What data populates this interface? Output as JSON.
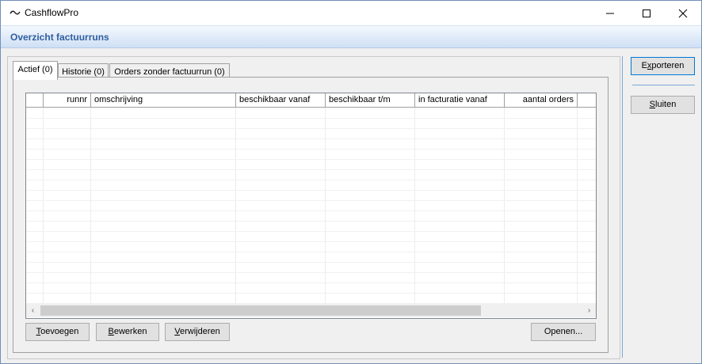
{
  "window": {
    "title": "CashflowPro",
    "minimize_icon": "minimize-icon",
    "maximize_icon": "maximize-icon",
    "close_icon": "close-icon"
  },
  "banner": {
    "title": "Overzicht factuurruns"
  },
  "tabs": [
    {
      "label": "Actief (0)",
      "active": true
    },
    {
      "label": "Historie (0)",
      "active": false
    },
    {
      "label": "Orders zonder factuurrun (0)",
      "active": false
    }
  ],
  "grid": {
    "columns": [
      "",
      "runnr",
      "omschrijving",
      "beschikbaar vanaf",
      "beschikbaar t/m",
      "in facturatie vanaf",
      "aantal orders"
    ],
    "rows": [],
    "scroll_left": "‹",
    "scroll_right": "›"
  },
  "buttons": {
    "toevoegen": {
      "mn": "T",
      "rest": "oevoegen"
    },
    "bewerken": {
      "mn": "B",
      "rest": "ewerken"
    },
    "verwijderen": {
      "mn": "V",
      "rest": "erwijderen"
    },
    "openen": "Openen..."
  },
  "side_buttons": {
    "exporteren": {
      "pre": "E",
      "mn": "x",
      "rest": "porteren"
    },
    "sluiten": {
      "mn": "S",
      "rest": "luiten"
    }
  },
  "colors": {
    "accent": "#2f5e9f",
    "focus_border": "#0078d7"
  }
}
